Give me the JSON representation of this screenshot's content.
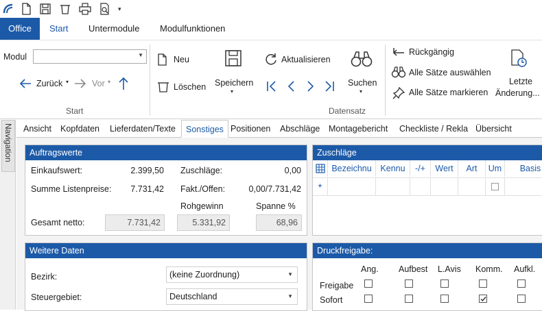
{
  "quick_access": {
    "icons": [
      "app-logo-icon",
      "new-doc-icon",
      "save-icon",
      "delete-icon",
      "print-icon",
      "preview-icon",
      "customize-dropdown-icon"
    ],
    "dropdown_glyph": "▾"
  },
  "menu": {
    "office": "Office",
    "tabs": [
      "Start",
      "Untermodule",
      "Modulfunktionen"
    ]
  },
  "ribbon": {
    "modul_label": "Modul",
    "modul_value": "",
    "back_label": "Zurück",
    "forward_label": "Vor",
    "start_group": "Start",
    "new_label": "Neu",
    "delete_label": "Löschen",
    "save_label": "Speichern",
    "refresh_label": "Aktualisieren",
    "search_label": "Suchen",
    "datensatz_group": "Datensatz",
    "undo_label": "Rückgängig",
    "select_all_label": "Alle Sätze auswählen",
    "mark_all_label": "Alle Sätze markieren",
    "last_changes_line1": "Letzte",
    "last_changes_line2": "Änderung..."
  },
  "navigation": {
    "label": "Navigation"
  },
  "tabs": [
    "Ansicht",
    "Kopfdaten",
    "Lieferdaten/Texte",
    "Sonstiges",
    "Positionen",
    "Abschläge",
    "Montagebericht",
    "Checkliste / Rekla",
    "Übersicht"
  ],
  "auftragswerte": {
    "title": "Auftragswerte",
    "einkaufswert_label": "Einkaufswert:",
    "einkaufswert_value": "2.399,50",
    "summe_label": "Summe Listenpreise:",
    "summe_value": "7.731,42",
    "zuschlaege_label": "Zuschläge:",
    "zuschlaege_value": "0,00",
    "fakt_label": "Fakt./Offen:",
    "fakt_value": "0,00/7.731,42",
    "rohgewinn_label": "Rohgewinn",
    "spanne_label": "Spanne %",
    "gesamt_label": "Gesamt netto:",
    "gesamt_value": "7.731,42",
    "rohgewinn_value": "5.331,92",
    "spanne_value": "68,96"
  },
  "zuschlaege_grid": {
    "title": "Zuschläge",
    "columns": [
      "Bezeichnu",
      "Kennu",
      "-/+",
      "Wert",
      "Art",
      "Um",
      "Basis"
    ],
    "new_row_marker": "*"
  },
  "weitere_daten": {
    "title": "Weitere Daten",
    "bezirk_label": "Bezirk:",
    "bezirk_value": "(keine Zuordnung)",
    "steuergebiet_label": "Steuergebiet:",
    "steuergebiet_value": "Deutschland"
  },
  "druckfreigabe": {
    "title": "Druckfreigabe:",
    "columns": [
      "Ang.",
      "Aufbest",
      "L.Avis",
      "Komm.",
      "Aufkl."
    ],
    "rows": [
      {
        "label": "Freigabe",
        "checked": [
          false,
          false,
          false,
          false,
          false
        ]
      },
      {
        "label": "Sofort",
        "checked": [
          false,
          false,
          false,
          true,
          false
        ]
      }
    ]
  },
  "colors": {
    "accent": "#1c5aa8",
    "header_text": "#ffffff",
    "readonly_bg": "#ececec"
  }
}
